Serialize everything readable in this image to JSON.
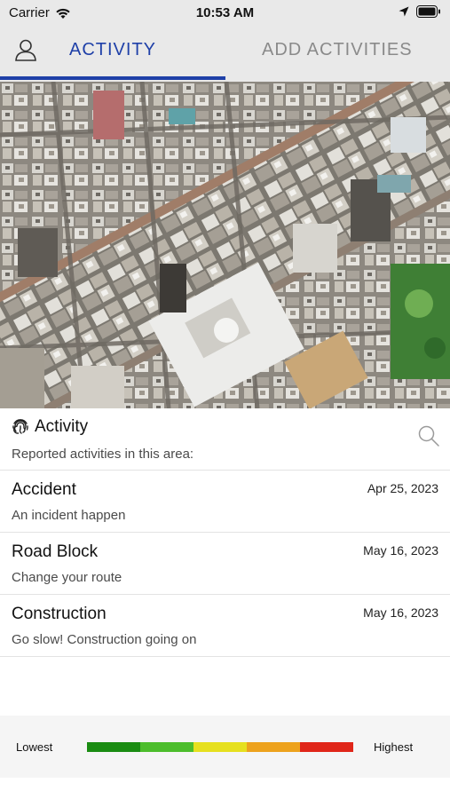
{
  "status_bar": {
    "carrier": "Carrier",
    "time": "10:53 AM",
    "icons": [
      "wifi-icon",
      "location-arrow-icon",
      "battery-icon"
    ]
  },
  "tabs": [
    {
      "label": "ACTIVITY",
      "active": true
    },
    {
      "label": "ADD ACTIVITIES",
      "active": false
    }
  ],
  "header_icons": {
    "user": "user-icon"
  },
  "accent_color": "#1f40a8",
  "activity_panel": {
    "title": "Activity",
    "subtitle": "Reported activities in this area:",
    "icons": [
      "fingerprint-icon",
      "search-icon"
    ]
  },
  "activities": [
    {
      "title": "Accident",
      "date": "Apr 25, 2023",
      "description": "An incident happen"
    },
    {
      "title": "Road Block",
      "date": "May 16, 2023",
      "description": "Change your route"
    },
    {
      "title": "Construction",
      "date": "May 16, 2023",
      "description": "Go slow! Construction going on"
    }
  ],
  "legend": {
    "low_label": "Lowest",
    "high_label": "Highest",
    "colors": [
      "#1a8c12",
      "#4cbd2c",
      "#e6e01f",
      "#eda21d",
      "#e02619"
    ]
  }
}
